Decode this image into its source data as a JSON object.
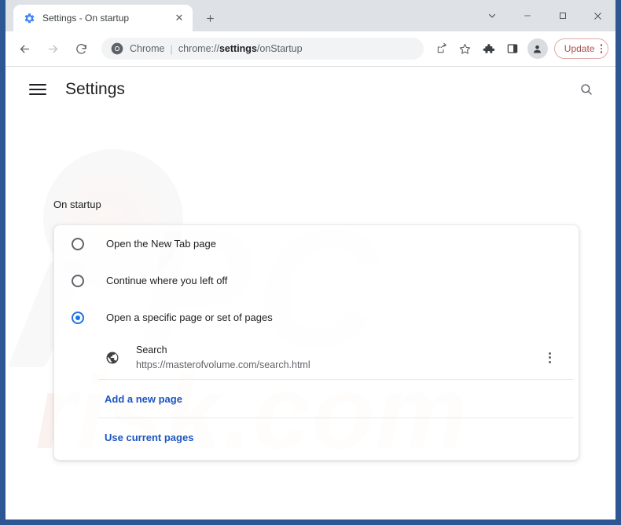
{
  "window": {
    "frame_color": "#2d5694",
    "controls": [
      {
        "name": "tab-search",
        "glyph": "⌄"
      },
      {
        "name": "minimize",
        "glyph": "–"
      },
      {
        "name": "maximize",
        "glyph": "□"
      },
      {
        "name": "close",
        "glyph": "✕"
      }
    ]
  },
  "tabstrip": {
    "tab": {
      "title": "Settings - On startup",
      "favicon": "gear-icon",
      "close_glyph": "✕"
    },
    "new_tab_glyph": "+",
    "new_tab_title": "New Tab"
  },
  "toolbar": {
    "back_glyph": "←",
    "forward_glyph": "→",
    "reload_glyph": "↻",
    "omnibox": {
      "icon": "chrome-logo-icon",
      "scheme_label": "Chrome",
      "separator": "|",
      "url_prefix": "chrome://",
      "url_emphasis": "settings",
      "url_suffix": "/onStartup",
      "full_url": "chrome://settings/onStartup"
    },
    "share_icon": "share-icon",
    "bookmark_icon": "star-icon",
    "extensions_icon": "puzzle-icon",
    "side_panel_icon": "side-panel-icon",
    "profile_icon": "avatar-icon",
    "update": {
      "label": "Update",
      "color": "#a8504c",
      "border_color": "#dfaaa8",
      "menu_icon": "three-dots-icon"
    }
  },
  "settings_header": {
    "menu_icon": "hamburger-icon",
    "title": "Settings",
    "search_icon": "search-icon"
  },
  "on_startup": {
    "section_label": "On startup",
    "options": [
      {
        "label": "Open the New Tab page",
        "checked": false
      },
      {
        "label": "Continue where you left off",
        "checked": false
      },
      {
        "label": "Open a specific page or set of pages",
        "checked": true
      }
    ],
    "pages": [
      {
        "icon": "globe-icon",
        "name": "Search",
        "url": "https://masterofvolume.com/search.html",
        "menu_icon": "three-dots-icon"
      }
    ],
    "actions": [
      {
        "label": "Add a new page",
        "name": "add-a-new-page-link"
      },
      {
        "label": "Use current pages",
        "name": "use-current-pages-link"
      }
    ],
    "accent_color": "#1a73e8",
    "link_color": "#1a56c4"
  },
  "watermark": {
    "primary": "PC",
    "secondary": "risk.com"
  }
}
